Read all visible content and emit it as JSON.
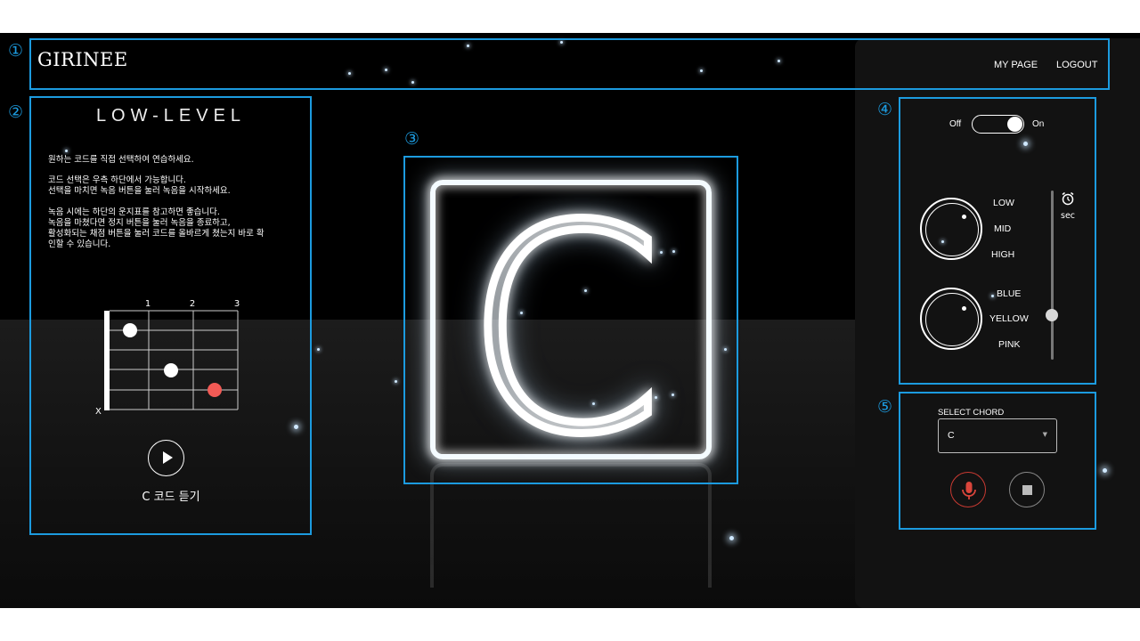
{
  "markers": [
    "①",
    "②",
    "③",
    "④",
    "⑤"
  ],
  "header": {
    "logo": "GIRINEE",
    "nav": [
      "MY PAGE",
      "LOGOUT"
    ]
  },
  "level_panel": {
    "title": "LOW-LEVEL",
    "description": [
      "원하는 코드를 직접 선택하여 연습하세요.",
      "코드 선택은 우측 하단에서 가능합니다.",
      "선택을 마치면 녹음 버튼을 눌러 녹음을 시작하세요.",
      "녹음 시에는 하단의 운지표를 참고하면 좋습니다.",
      "녹음을 마쳤다면 정지 버튼을 눌러 녹음을 종료하고,",
      "활성화되는 채점 버튼을 눌러 코드를 올바르게 쳤는지 바로 확",
      "인할 수 있습니다."
    ],
    "fret_numbers": [
      "1",
      "2",
      "3"
    ],
    "muted_string_label": "X",
    "listen_label": "C 코드 듣기"
  },
  "chord_display": {
    "chord": "C"
  },
  "controls": {
    "switch_off_label": "Off",
    "switch_on_label": "On",
    "switch_state": "on",
    "level_labels": [
      "LOW",
      "MID",
      "HIGH"
    ],
    "color_labels": [
      "BLUE",
      "YELLOW",
      "PINK"
    ],
    "timer_unit": "sec",
    "timer_slider_fraction": 0.24
  },
  "chord_select": {
    "label": "SELECT CHORD",
    "value": "C"
  },
  "colors": {
    "annotation": "#1c9bdf",
    "record": "#d9453b",
    "fret_dot_highlight": "#f25a55"
  }
}
